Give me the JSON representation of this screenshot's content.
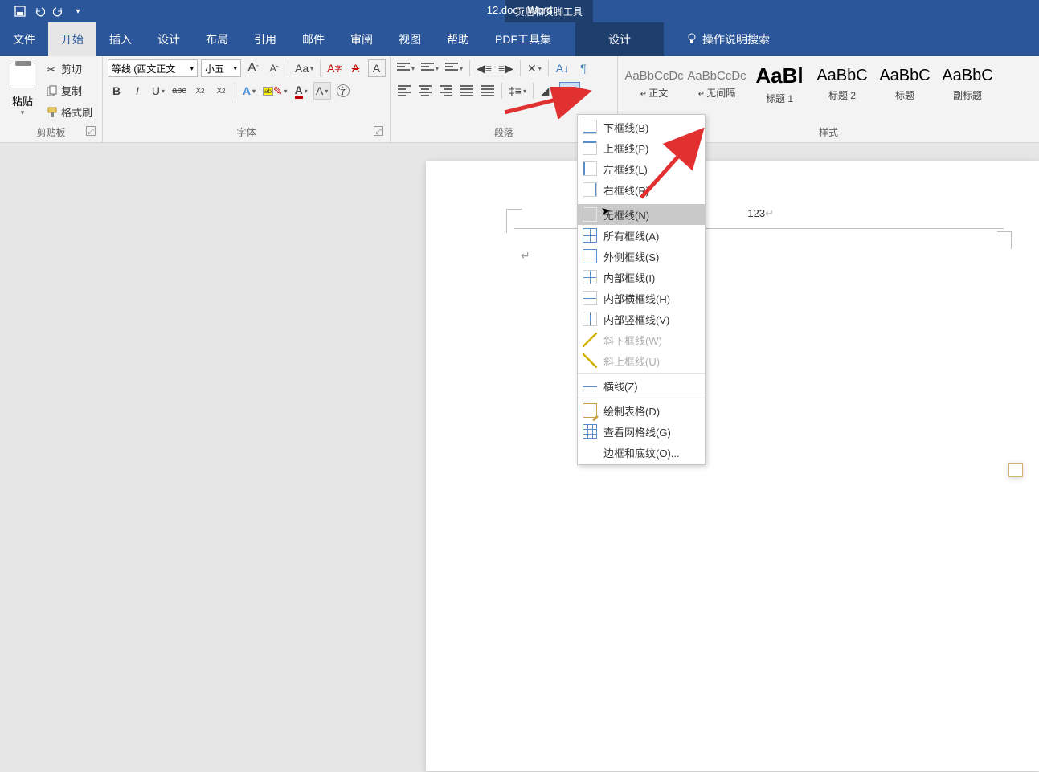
{
  "titlebar": {
    "doc_title": "12.doc  -  Word",
    "context_tool": "页眉和页脚工具"
  },
  "qat": {
    "save": "save",
    "undo": "undo",
    "redo": "redo",
    "custom": "custom"
  },
  "tabs": {
    "file": "文件",
    "home": "开始",
    "insert": "插入",
    "design": "设计",
    "layout": "布局",
    "references": "引用",
    "mailings": "邮件",
    "review": "审阅",
    "view": "视图",
    "help": "帮助",
    "pdf": "PDF工具集",
    "context_design": "设计",
    "tellme": "操作说明搜索"
  },
  "ribbon": {
    "clipboard": {
      "paste": "粘贴",
      "cut": "剪切",
      "copy": "复制",
      "format_painter": "格式刷",
      "group_label": "剪贴板"
    },
    "font": {
      "font_name": "等线 (西文正文",
      "font_size": "小五",
      "grow": "A",
      "shrink": "A",
      "case": "Aa",
      "clear": "A",
      "bold": "B",
      "italic": "I",
      "underline": "U",
      "strike": "abc",
      "subscript": "X",
      "superscript": "X",
      "group_label": "字体"
    },
    "paragraph": {
      "group_label": "段落"
    },
    "styles": {
      "group_label": "样式",
      "items": [
        {
          "sample": "AaBbCcDc",
          "name": "正文",
          "corner": true
        },
        {
          "sample": "AaBbCcDc",
          "name": "无间隔",
          "corner": true
        },
        {
          "sample": "AaBl",
          "name": "标题 1",
          "big": true
        },
        {
          "sample": "AaBbC",
          "name": "标题 2",
          "h": true
        },
        {
          "sample": "AaBbC",
          "name": "标题",
          "h": true
        },
        {
          "sample": "AaBbC",
          "name": "副标题",
          "h": true
        }
      ]
    }
  },
  "border_menu": {
    "items": [
      {
        "label": "下框线(B)",
        "ic": "bottom"
      },
      {
        "label": "上框线(P)",
        "ic": "top"
      },
      {
        "label": "左框线(L)",
        "ic": "left"
      },
      {
        "label": "右框线(R)",
        "ic": "right"
      }
    ],
    "no_border": "无框线(N)",
    "items2": [
      {
        "label": "所有框线(A)",
        "ic": "all"
      },
      {
        "label": "外侧框线(S)",
        "ic": "outside"
      },
      {
        "label": "内部框线(I)",
        "ic": "inside"
      },
      {
        "label": "内部横框线(H)",
        "ic": "inh"
      },
      {
        "label": "内部竖框线(V)",
        "ic": "inv"
      },
      {
        "label": "斜下框线(W)",
        "ic": "diagdown",
        "disabled": true
      },
      {
        "label": "斜上框线(U)",
        "ic": "diagup",
        "disabled": true
      }
    ],
    "hline": "横线(Z)",
    "items3": [
      {
        "label": "绘制表格(D)",
        "ic": "draw"
      },
      {
        "label": "查看网格线(G)",
        "ic": "grid"
      },
      {
        "label": "边框和底纹(O)...",
        "ic": "page"
      }
    ]
  },
  "document": {
    "header_text": "123",
    "cursor": "↵"
  }
}
